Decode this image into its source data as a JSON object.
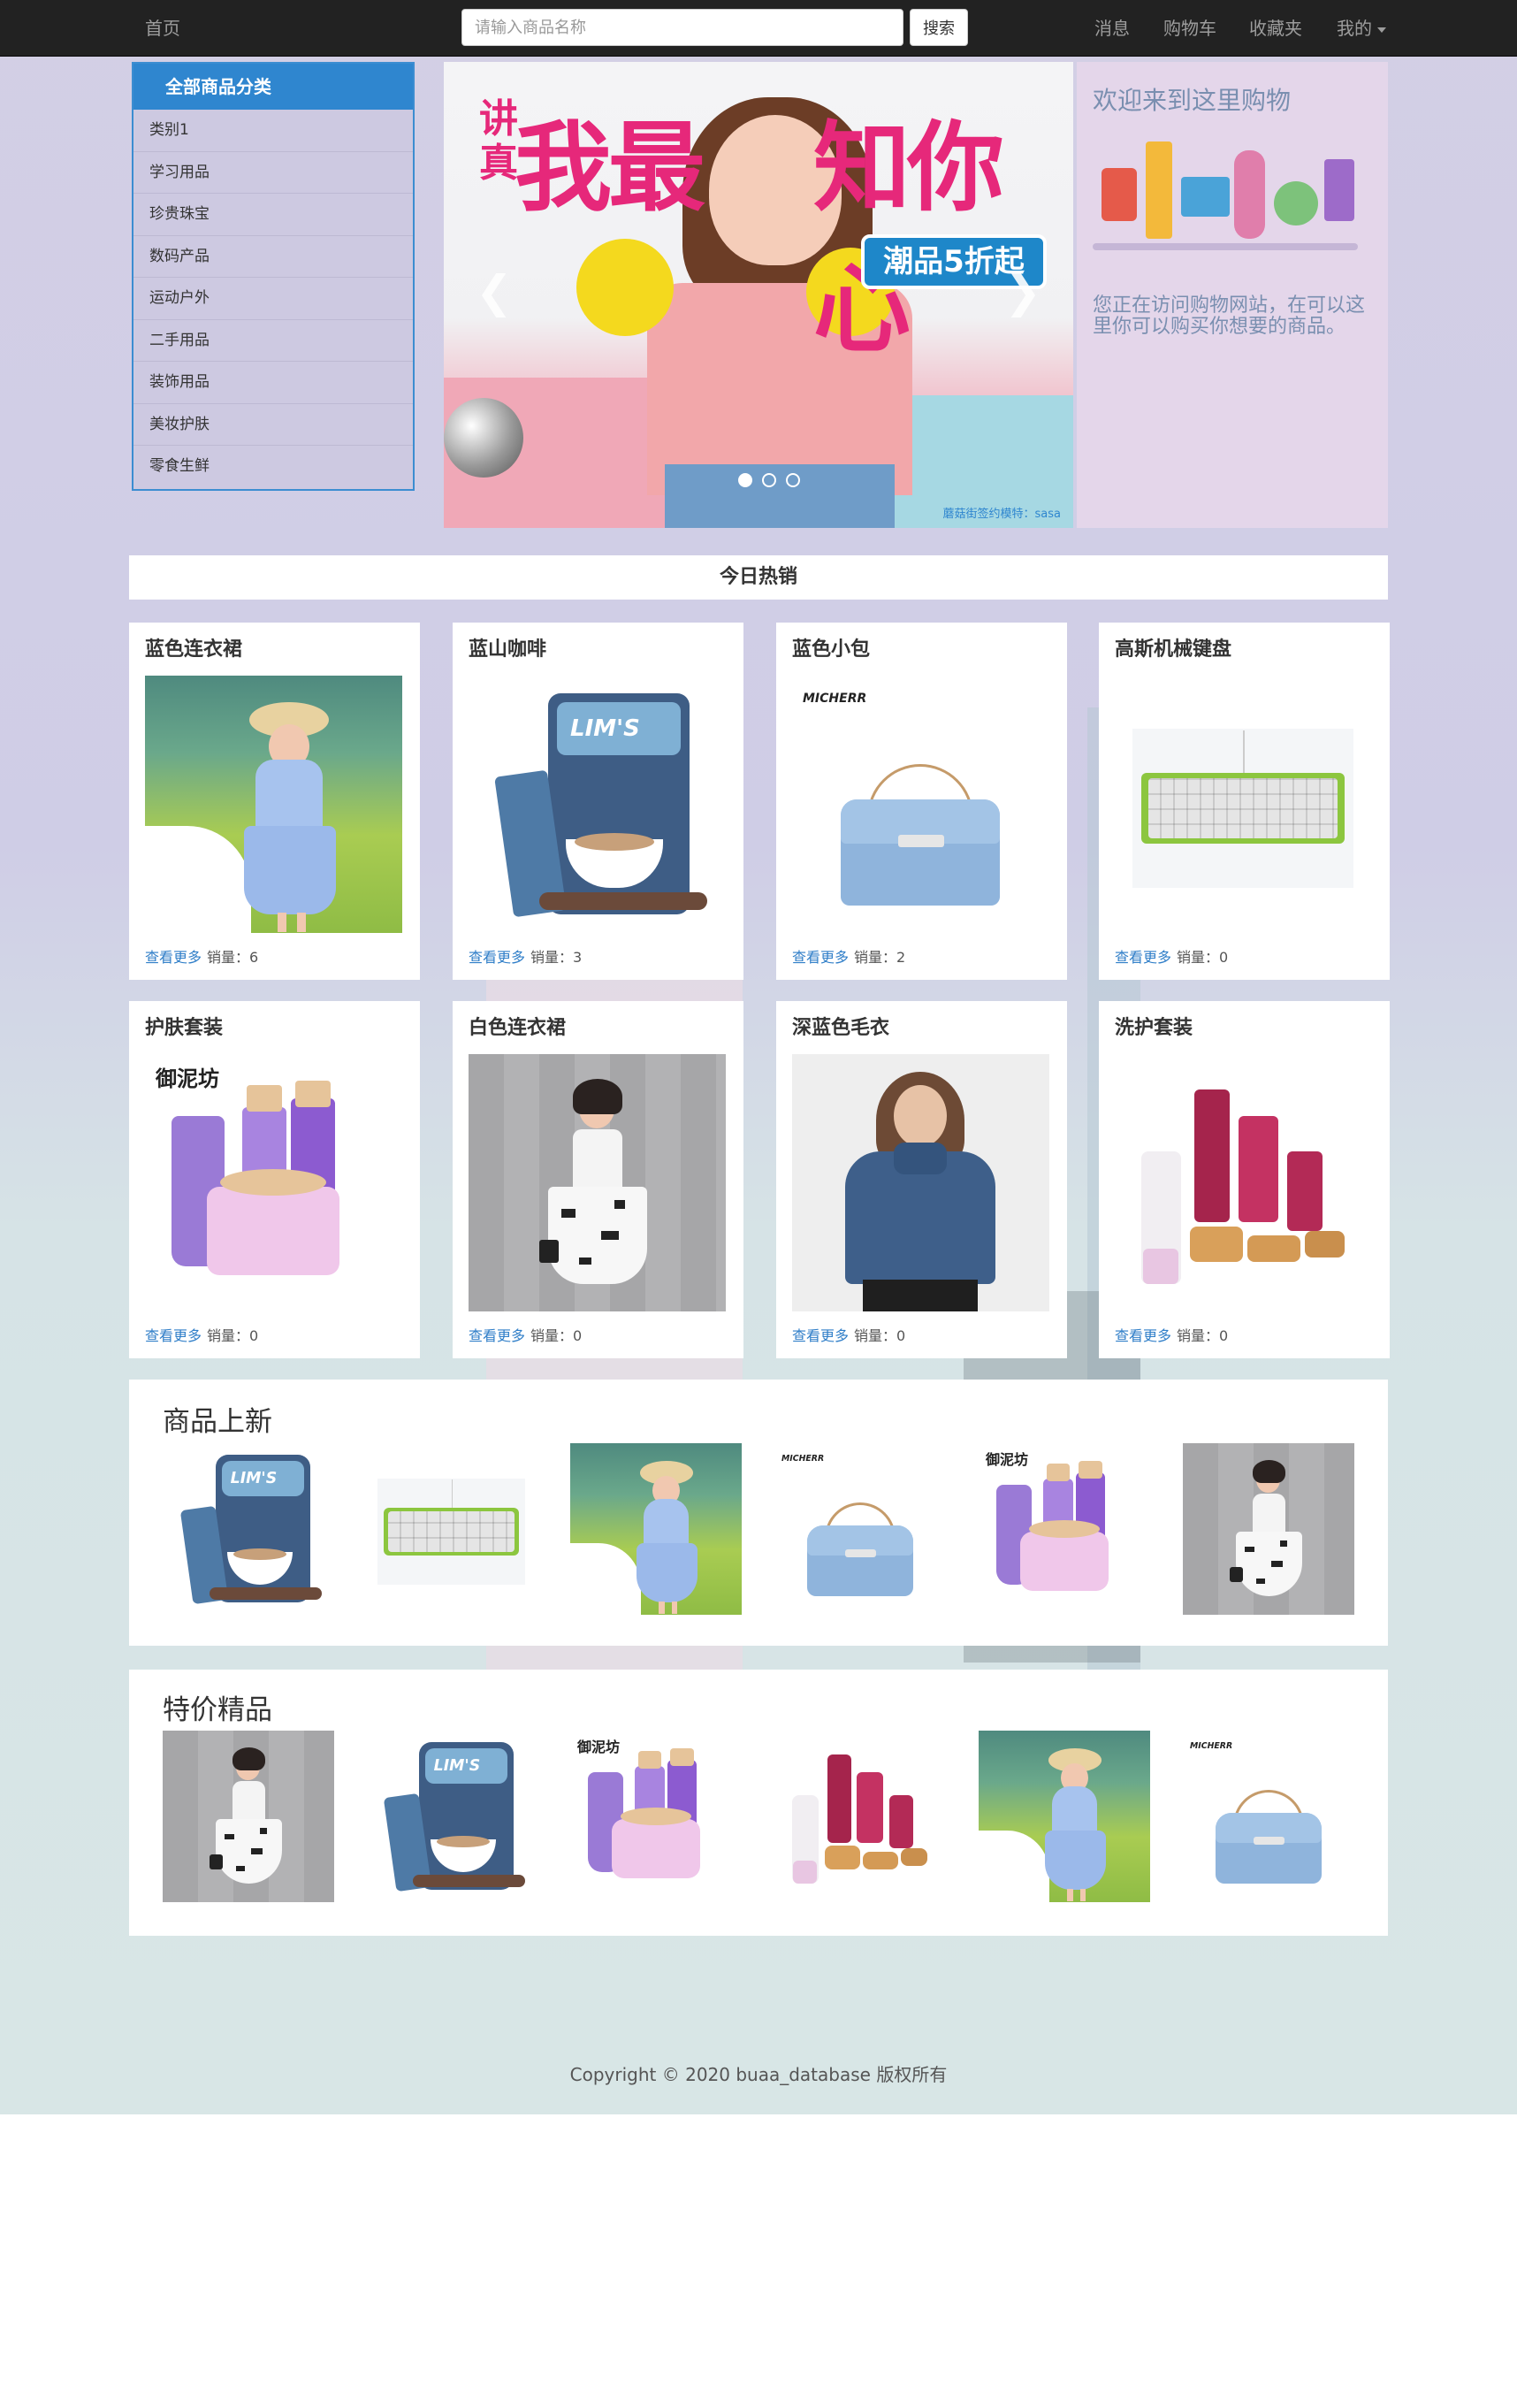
{
  "nav": {
    "home": "首页",
    "search_placeholder": "请输入商品名称",
    "search_button": "搜索",
    "messages": "消息",
    "cart": "购物车",
    "favorites": "收藏夹",
    "mine": "我的"
  },
  "categories": {
    "title": "全部商品分类",
    "items": [
      "类别1",
      "学习用品",
      "珍贵珠宝",
      "数码产品",
      "运动户外",
      "二手用品",
      "装饰用品",
      "美妆护肤",
      "零食生鲜"
    ]
  },
  "carousel": {
    "headline_left": "我最",
    "headline_right": "知你心",
    "headline_small": "讲真",
    "badge": "潮品5折起",
    "caption": "蘑菇街签约模特：sasa"
  },
  "welcome": {
    "title": "欢迎来到这里购物",
    "text": "您正在访问购物网站，在可以这里你可以购买你想要的商品。"
  },
  "hot": {
    "title": "今日热销",
    "more_label": "查看更多",
    "sales_label": "销量：",
    "products": [
      {
        "name": "蓝色连衣裙",
        "sales": "6",
        "image": "blue-dress"
      },
      {
        "name": "蓝山咖啡",
        "sales": "3",
        "image": "coffee"
      },
      {
        "name": "蓝色小包",
        "sales": "2",
        "image": "blue-bag"
      },
      {
        "name": "高斯机械键盘",
        "sales": "0",
        "image": "keyboard"
      },
      {
        "name": "护肤套装",
        "sales": "0",
        "image": "skincare"
      },
      {
        "name": "白色连衣裙",
        "sales": "0",
        "image": "white-dress"
      },
      {
        "name": "深蓝色毛衣",
        "sales": "0",
        "image": "sweater"
      },
      {
        "name": "洗护套装",
        "sales": "0",
        "image": "haircare"
      }
    ]
  },
  "new_arrivals": {
    "title": "商品上新",
    "items": [
      "coffee",
      "keyboard",
      "blue-dress",
      "blue-bag",
      "skincare",
      "white-dress"
    ]
  },
  "specials": {
    "title": "特价精品",
    "items": [
      "white-dress",
      "coffee",
      "skincare",
      "haircare",
      "blue-dress",
      "blue-bag"
    ]
  },
  "brand_labels": {
    "bag": "MICHERR",
    "skincare": "御泥坊",
    "coffee": "LIM'S"
  },
  "footer": "Copyright © 2020  buaa_database 版权所有"
}
